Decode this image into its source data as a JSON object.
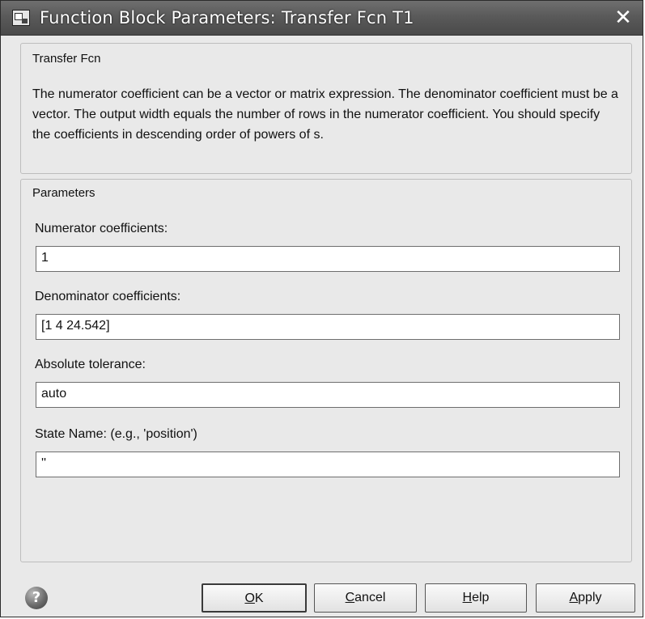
{
  "window": {
    "title": "Function Block Parameters: Transfer Fcn T1",
    "close_glyph": "✕",
    "icon": "simulink-block-icon"
  },
  "description": {
    "group_title": "Transfer Fcn",
    "text": "The numerator coefficient can be a vector or matrix expression. The denominator coefficient must be a vector. The output width equals the number of rows in the numerator coefficient. You should specify the coefficients in descending order of powers of s."
  },
  "parameters": {
    "group_title": "Parameters",
    "fields": [
      {
        "label": "Numerator coefficients:",
        "value": "1"
      },
      {
        "label": "Denominator coefficients:",
        "value": "[1 4 24.542]"
      },
      {
        "label": "Absolute tolerance:",
        "value": "auto"
      },
      {
        "label": "State Name: (e.g., 'position')",
        "value": "''"
      }
    ]
  },
  "buttons": {
    "help_icon": "?",
    "ok": {
      "label": "OK",
      "mnemonic": "O",
      "rest": "K"
    },
    "cancel": {
      "label": "Cancel",
      "mnemonic": "C",
      "rest": "ancel"
    },
    "help": {
      "label": "Help",
      "mnemonic": "H",
      "rest": "elp"
    },
    "apply": {
      "label": "Apply",
      "mnemonic": "A",
      "rest": "pply"
    }
  }
}
